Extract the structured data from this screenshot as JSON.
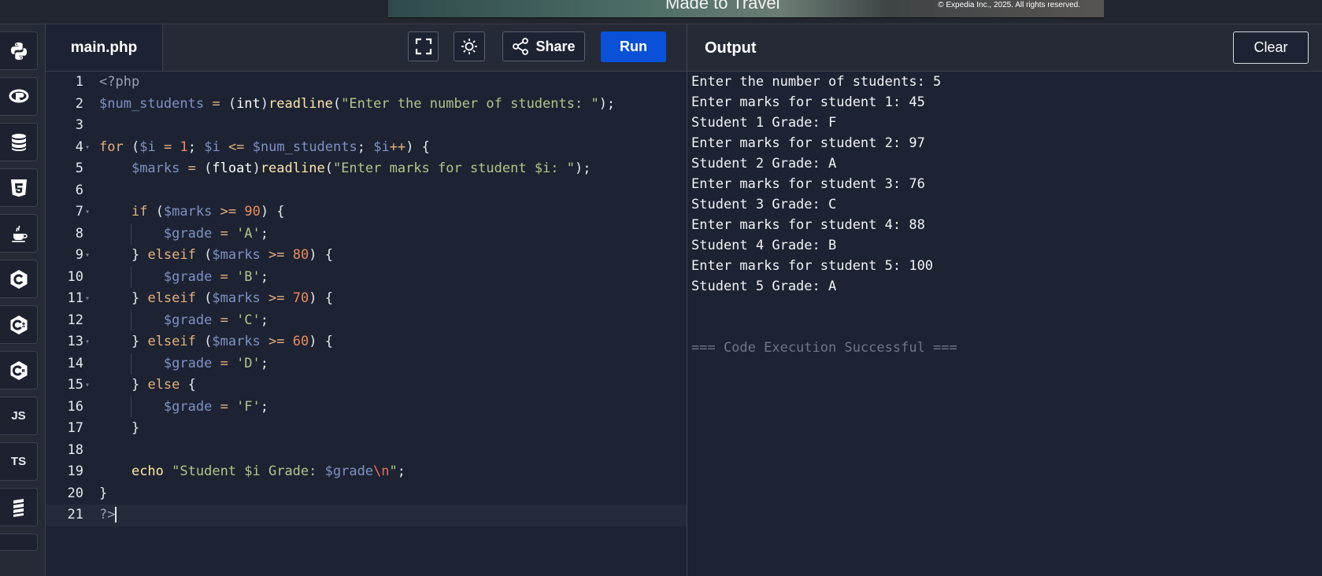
{
  "ad": {
    "headline": "Made to Travel",
    "copyright": "© Expedia Inc., 2025. All rights reserved."
  },
  "sidebar": {
    "languages": [
      {
        "name": "Python",
        "icon": "python-icon"
      },
      {
        "name": "R",
        "icon": "r-icon"
      },
      {
        "name": "SQL",
        "icon": "database-icon"
      },
      {
        "name": "HTML",
        "icon": "html5-icon"
      },
      {
        "name": "Java",
        "icon": "java-icon"
      },
      {
        "name": "C",
        "icon": "c-icon"
      },
      {
        "name": "C++",
        "icon": "cpp-icon"
      },
      {
        "name": "C#",
        "icon": "csharp-icon"
      },
      {
        "name": "JavaScript",
        "label": "JS",
        "icon": "js-icon"
      },
      {
        "name": "TypeScript",
        "label": "TS",
        "icon": "ts-icon"
      },
      {
        "name": "More",
        "icon": "stack-icon"
      }
    ]
  },
  "editor": {
    "file_name": "main.php",
    "share_label": "Share",
    "run_label": "Run",
    "line_numbers": [
      "1",
      "2",
      "3",
      "4",
      "5",
      "6",
      "7",
      "8",
      "9",
      "10",
      "11",
      "12",
      "13",
      "14",
      "15",
      "16",
      "17",
      "18",
      "19",
      "20",
      "21"
    ]
  },
  "output": {
    "title": "Output",
    "clear_label": "Clear",
    "lines": [
      "Enter the number of students: 5",
      "Enter marks for student 1: 45",
      "Student 1 Grade: F",
      "Enter marks for student 2: 97",
      "Student 2 Grade: A",
      "Enter marks for student 3: 76",
      "Student 3 Grade: C",
      "Enter marks for student 4: 88",
      "Student 4 Grade: B",
      "Enter marks for student 5: 100",
      "Student 5 Grade: A"
    ],
    "status": "=== Code Execution Successful ==="
  },
  "colors": {
    "run_button": "#0a51d8",
    "background": "#1d2333",
    "keyword": "#e6b17d",
    "variable": "#7f92c4",
    "string": "#b3c58a",
    "number": "#ef8a5a"
  }
}
